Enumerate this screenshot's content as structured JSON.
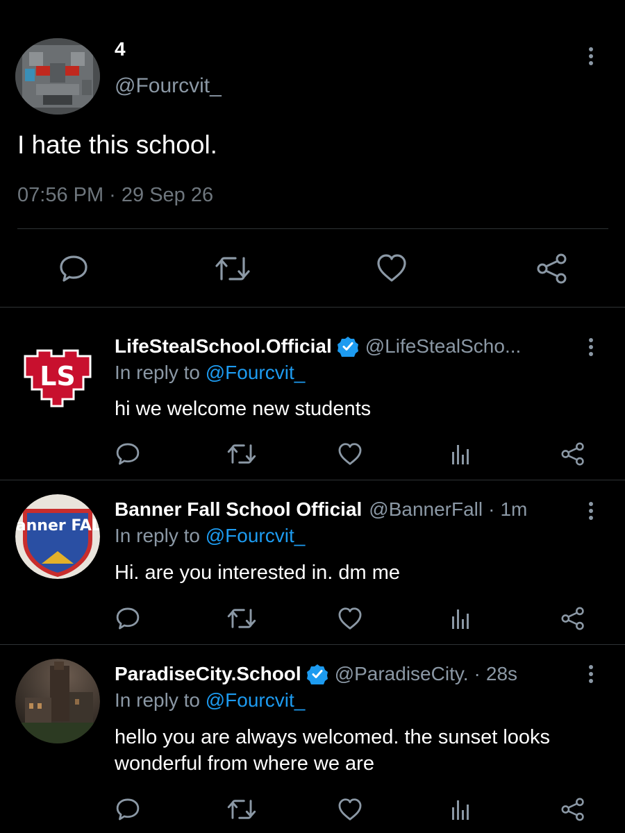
{
  "main_tweet": {
    "display_name": "4",
    "handle": "@Fourcvit_",
    "text": "I hate this school.",
    "timestamp": "07:56 PM · 29 Sep 26",
    "actions": [
      "reply-icon",
      "retweet-icon",
      "like-icon",
      "share-icon"
    ]
  },
  "replies": [
    {
      "display_name": "LifeStealSchool.Official",
      "verified": true,
      "handle": "@LifeStealScho...",
      "age": "",
      "in_reply_prefix": "In reply to ",
      "in_reply_to": "@Fourcvit_",
      "text": "hi we welcome new students",
      "avatar_text": "LS"
    },
    {
      "display_name": "Banner Fall School Official",
      "verified": false,
      "handle": "@BannerFall",
      "age": "1m",
      "in_reply_prefix": "In reply to ",
      "in_reply_to": "@Fourcvit_",
      "text": "Hi. are you interested in. dm me",
      "avatar_text": "Banner FALL"
    },
    {
      "display_name": "ParadiseCity.School",
      "verified": true,
      "handle": "@ParadiseCity.",
      "age": "28s",
      "in_reply_prefix": "In reply to ",
      "in_reply_to": "@Fourcvit_",
      "text": "hello you are always welcomed. the sunset looks wonderful from where we are"
    }
  ],
  "separator": "·",
  "colors": {
    "background": "#000000",
    "primary_text": "#ffffff",
    "secondary_text": "#8b98a5",
    "link": "#1d9bf0",
    "verified_badge": "#1d9bf0",
    "divider": "#2f3336"
  }
}
